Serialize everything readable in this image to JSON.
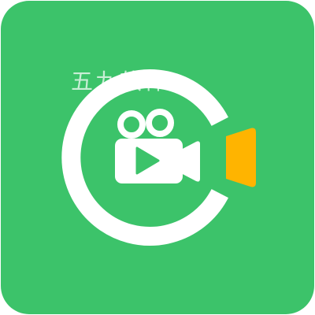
{
  "icon": {
    "name": "video-camera-icon",
    "colors": {
      "background": "#3CC36A",
      "ring": "#FFFFFF",
      "camera_body": "#FFFFFF",
      "play_triangle": "#3CC36A",
      "accent_tab": "#FFB400"
    }
  },
  "watermark": {
    "text": "五九软件"
  }
}
